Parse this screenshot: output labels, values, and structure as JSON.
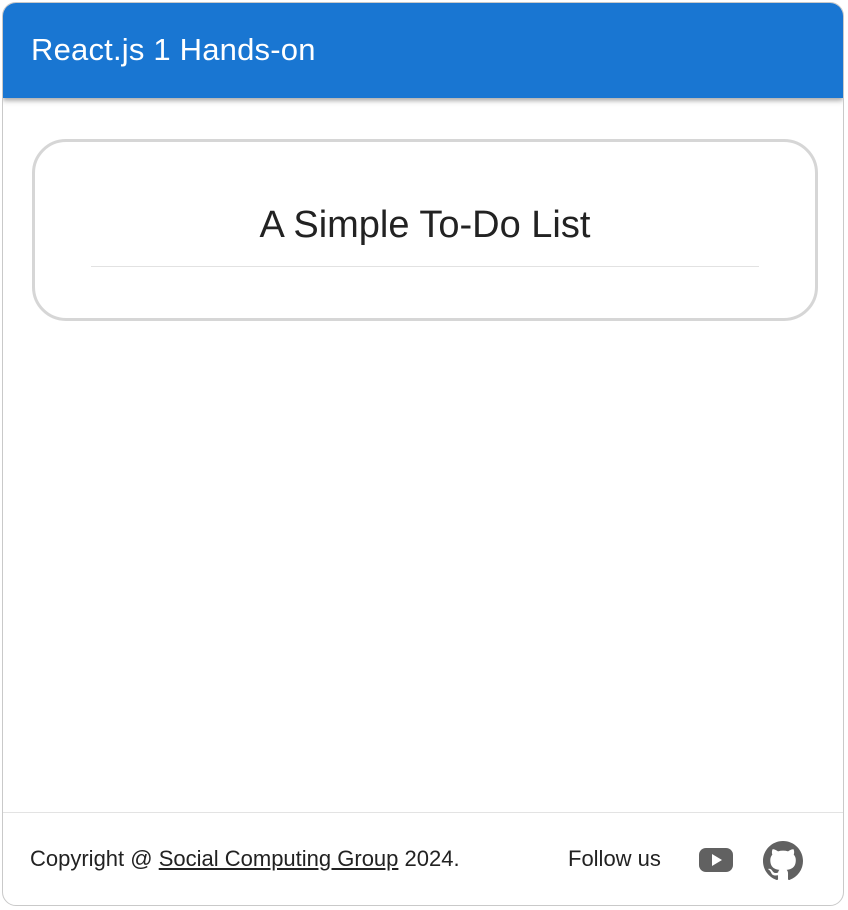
{
  "header": {
    "title": "React.js 1 Hands-on"
  },
  "main": {
    "card_title": "A Simple To-Do List"
  },
  "footer": {
    "copyright_prefix": "Copyright @ ",
    "copyright_link": "Social Computing Group",
    "copyright_suffix": " 2024.",
    "follow_label": "Follow us",
    "icons": [
      "youtube-icon",
      "github-icon"
    ]
  },
  "colors": {
    "appbar": "#1976d2",
    "icon": "#616161"
  }
}
